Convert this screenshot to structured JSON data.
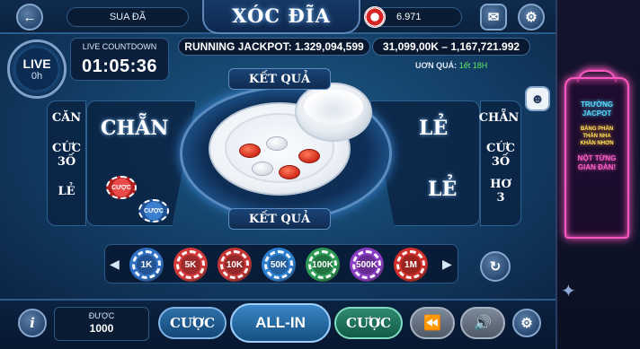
{
  "header": {
    "back_icon": "arrow-left-icon",
    "username": "SUA ĐÃ",
    "title": "XÓC ĐĨA",
    "balance": "6.971",
    "mail_icon": "mail-icon",
    "settings_icon": "gear-icon"
  },
  "live": {
    "label": "LIVE",
    "sub": "0h"
  },
  "countdown": {
    "label": "LIVE COUNTDOWN",
    "value": "01:05:36"
  },
  "jackpot": {
    "running": "RUNNING JACKPOT:  1.329,094,599",
    "secondary": "31,099,00K  –  1,167,721.992",
    "winner_prefix": "UƠN QUÁ:",
    "winner_value": "1ết 18H"
  },
  "table": {
    "left_main": "CHẴN",
    "left_small": [
      "CĂN",
      "CỨC\n3Ố",
      "LẺ"
    ],
    "right_main_top": "LẺ",
    "right_main_bottom": "LẺ",
    "right_small": [
      "CHẴN",
      "CỨC\n3Ố",
      "HƠ\n3"
    ],
    "result_top": "KẾT QUẢ",
    "result_bottom": "KẾT QUẢ",
    "chip_label": "CƯỢC"
  },
  "chips": [
    {
      "label": "1K",
      "color": "#2f6fc4"
    },
    {
      "label": "5K",
      "color": "#d23a3a"
    },
    {
      "label": "10K",
      "color": "#c43636"
    },
    {
      "label": "50K",
      "color": "#2f7fd0"
    },
    {
      "label": "100K",
      "color": "#2e9a56"
    },
    {
      "label": "500K",
      "color": "#8a3cc2"
    },
    {
      "label": "1M",
      "color": "#d0302a"
    }
  ],
  "bottom": {
    "info_icon": "info-icon",
    "prize_label": "ĐƯỢC",
    "prize_value": "1000",
    "bet_left": "CƯỢC",
    "all_in": "ALL-IN",
    "bet_right": "CƯỢC",
    "rewind_icon": "rewind-icon",
    "sound_icon": "speaker-icon",
    "settings_icon": "gear-icon"
  },
  "side_sign": {
    "line1": "TRƯỜNG\nJACPOT",
    "line2": "BẢNG PHẦN\nTHẦN NHA\nKHẦN NHƠN",
    "line3": "NỘT TỪNG\nGIAN ĐÀN!"
  }
}
